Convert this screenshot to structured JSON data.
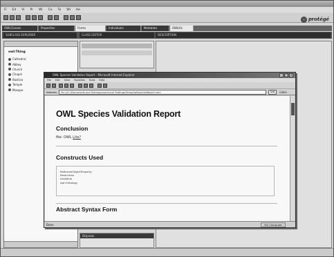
{
  "app": {
    "menu": [
      "Fi",
      "Ed",
      "Vi",
      "Pr",
      "Wi",
      "Co",
      "To",
      "Wi",
      "He"
    ],
    "logo": "protégé",
    "tabs": [
      "OWLClasses",
      "Properties",
      "Forms",
      "Individuals",
      "Metadata",
      "OWLViz"
    ],
    "subpanels": [
      "SUBCLASS EXPLORER",
      "CLASS EDITOR",
      "DESCRIPTION"
    ],
    "tree_root": "owl:Thing",
    "tree_items": [
      "Cathedral",
      "Abbey",
      "Church",
      "Chapel",
      "Basilica",
      "Temple",
      "Mosque"
    ],
    "mid_bottom_title": "Disjoints"
  },
  "browser": {
    "title": "OWL Species Validation Report - Microsoft Internet Explorer",
    "menu": [
      "File",
      "Edit",
      "View",
      "Favorites",
      "Tools",
      "Help"
    ],
    "address_label": "Address",
    "address_value": "file:///C:/Documents and Settings/user/Local Settings/Temp/owlSpeciesReport.html",
    "go_label": "Go",
    "links_label": "Links",
    "status_left": "Done",
    "status_right": "My Computer"
  },
  "report": {
    "title": "OWL Species Validation Report",
    "conclusion_heading": "Conclusion",
    "conclusion_prefix": "file: OWL ",
    "conclusion_link": "Lite?",
    "constructs_heading": "Constructs Used",
    "constructs": [
      "ReflexiveObjectProperty",
      "Restriction",
      "hasValue",
      "owl:Ontology"
    ],
    "abstract_heading": "Abstract Syntax Form"
  }
}
